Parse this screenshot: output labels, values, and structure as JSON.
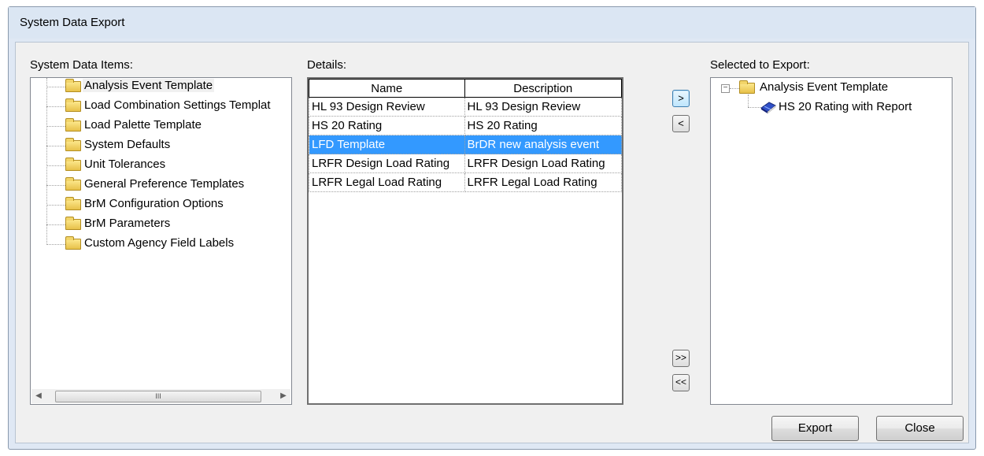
{
  "window": {
    "title": "System Data Export"
  },
  "left_panel": {
    "label": "System Data Items:",
    "items": [
      "Analysis Event Template",
      "Load Combination Settings Templat",
      "Load Palette Template",
      "System Defaults",
      "Unit Tolerances",
      "General Preference Templates",
      "BrM Configuration Options",
      "BrM Parameters",
      "Custom Agency Field Labels"
    ],
    "scroll_thumb_grip": "III"
  },
  "details": {
    "label": "Details:",
    "columns": [
      "Name",
      "Description"
    ],
    "rows": [
      [
        "HL 93 Design Review",
        "HL 93 Design Review"
      ],
      [
        "HS 20 Rating",
        "HS 20 Rating"
      ],
      [
        "LFD Template",
        "BrDR new analysis event"
      ],
      [
        "LRFR Design Load Rating",
        "LRFR Design Load Rating"
      ],
      [
        "LRFR Legal Load Rating",
        "LRFR Legal Load Rating"
      ]
    ],
    "selected_row": 2
  },
  "transfer_buttons": {
    "add": ">",
    "remove": "<",
    "add_all": ">>",
    "remove_all": "<<"
  },
  "right_panel": {
    "label": "Selected to Export:",
    "expander": "−",
    "parent": "Analysis Event Template",
    "child": "HS 20 Rating with Report"
  },
  "buttons": {
    "export": "Export",
    "close": "Close"
  },
  "colors": {
    "selection": "#3399ff",
    "title_bar": "#dbe6f3",
    "dialog_bg": "#f0f0f0"
  }
}
